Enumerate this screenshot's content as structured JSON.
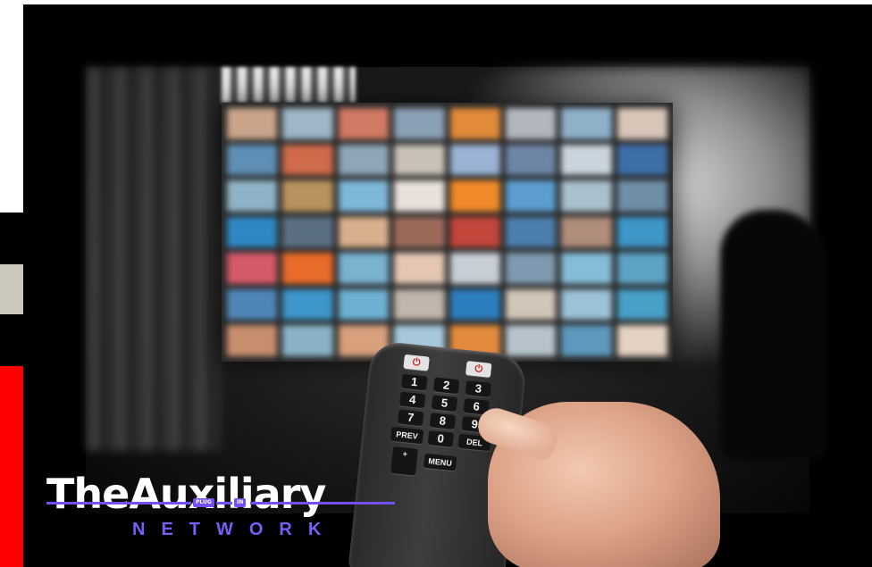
{
  "brand": {
    "title": "TheAuxiliary",
    "subtitle": "NETWORK",
    "plug_left": "PLUG",
    "plug_right": "IN",
    "accent_color": "#7350f2"
  },
  "edge_colors": {
    "white": "#ffffff",
    "beige": "#cbc7bc",
    "black": "#000000",
    "red": "#ff0000"
  },
  "remote": {
    "buttons": [
      "1",
      "2",
      "3",
      "4",
      "5",
      "6",
      "7",
      "8",
      "9",
      "PREV",
      "0",
      "DEL",
      "+",
      "MENU"
    ],
    "power_symbol": "⏻"
  },
  "tv": {
    "tile_colors": [
      "#c9a48a",
      "#9eb6c8",
      "#d07a63",
      "#8aa0b4",
      "#e08a3a",
      "#b3b6bf",
      "#8fb0c9",
      "#d8c5b8",
      "#5f8fb5",
      "#cf6b4a",
      "#8fa6b8",
      "#c7c1b7",
      "#9bb3d4",
      "#6e86a6",
      "#c9d4dc",
      "#3e6fa8",
      "#8fb3c6",
      "#b9935f",
      "#7fb7d8",
      "#e8e1d9",
      "#f08a2a",
      "#5b9ecf",
      "#a9c0cd",
      "#6f8ea8",
      "#2f88c4",
      "#5b6f83",
      "#d9b08c",
      "#9b6b5a",
      "#c2463a",
      "#4d7fae",
      "#b08e7b",
      "#3f96c9",
      "#d35a6a",
      "#e96b2a",
      "#7ab2d0",
      "#e4c6b3",
      "#c8cfd6",
      "#7f9ab0",
      "#86bcd7",
      "#5da3c4",
      "#4f86b8",
      "#3e95c9",
      "#6db1d2",
      "#c0b6ac",
      "#2c7fbe",
      "#d2c6b9",
      "#9cc2d8",
      "#48a0c8",
      "#c78e6e",
      "#8ab2c7",
      "#d8a07c",
      "#a6c8da",
      "#e38b3d",
      "#b7c3cb",
      "#5f98bd",
      "#e4d2c2"
    ]
  }
}
